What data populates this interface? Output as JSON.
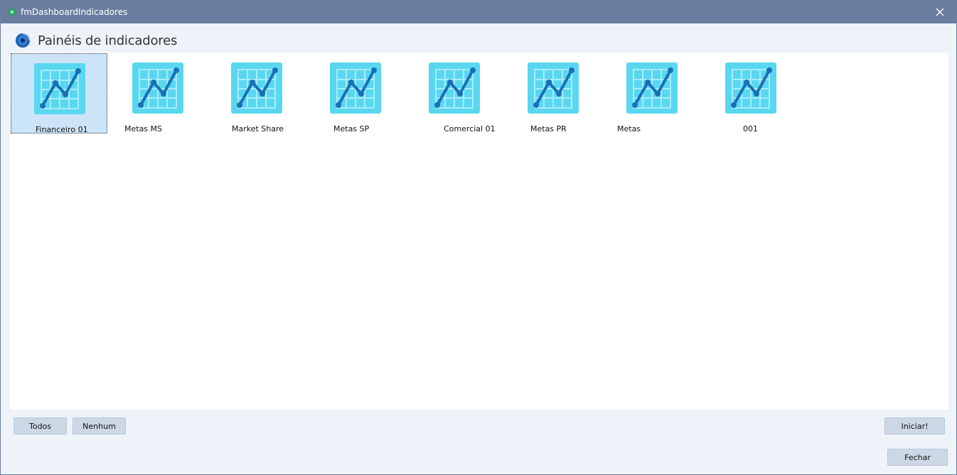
{
  "window": {
    "title": "fmDashboardIndicadores"
  },
  "header": {
    "title": "Painéis de indicadores"
  },
  "items": [
    {
      "label": "Financeiro 01",
      "selected": true
    },
    {
      "label": "Metas MS"
    },
    {
      "label": "Market Share"
    },
    {
      "label": "Metas SP"
    },
    {
      "label": "Comercial 01"
    },
    {
      "label": "Metas PR"
    },
    {
      "label": "Metas"
    },
    {
      "label": "001"
    }
  ],
  "buttons": {
    "todos": "Todos",
    "nenhum": "Nenhum",
    "iniciar": "Iniciar!",
    "fechar": "Fechar"
  },
  "colors": {
    "titlebar": "#6b7d9f",
    "tile": "#5ad7f0",
    "chart_line": "#1a6fb5",
    "selection": "#cce4f7"
  },
  "icons": {
    "window": "green-app-icon",
    "header": "dashboard-globe-icon",
    "tile": "line-chart-icon",
    "close": "close-icon"
  }
}
